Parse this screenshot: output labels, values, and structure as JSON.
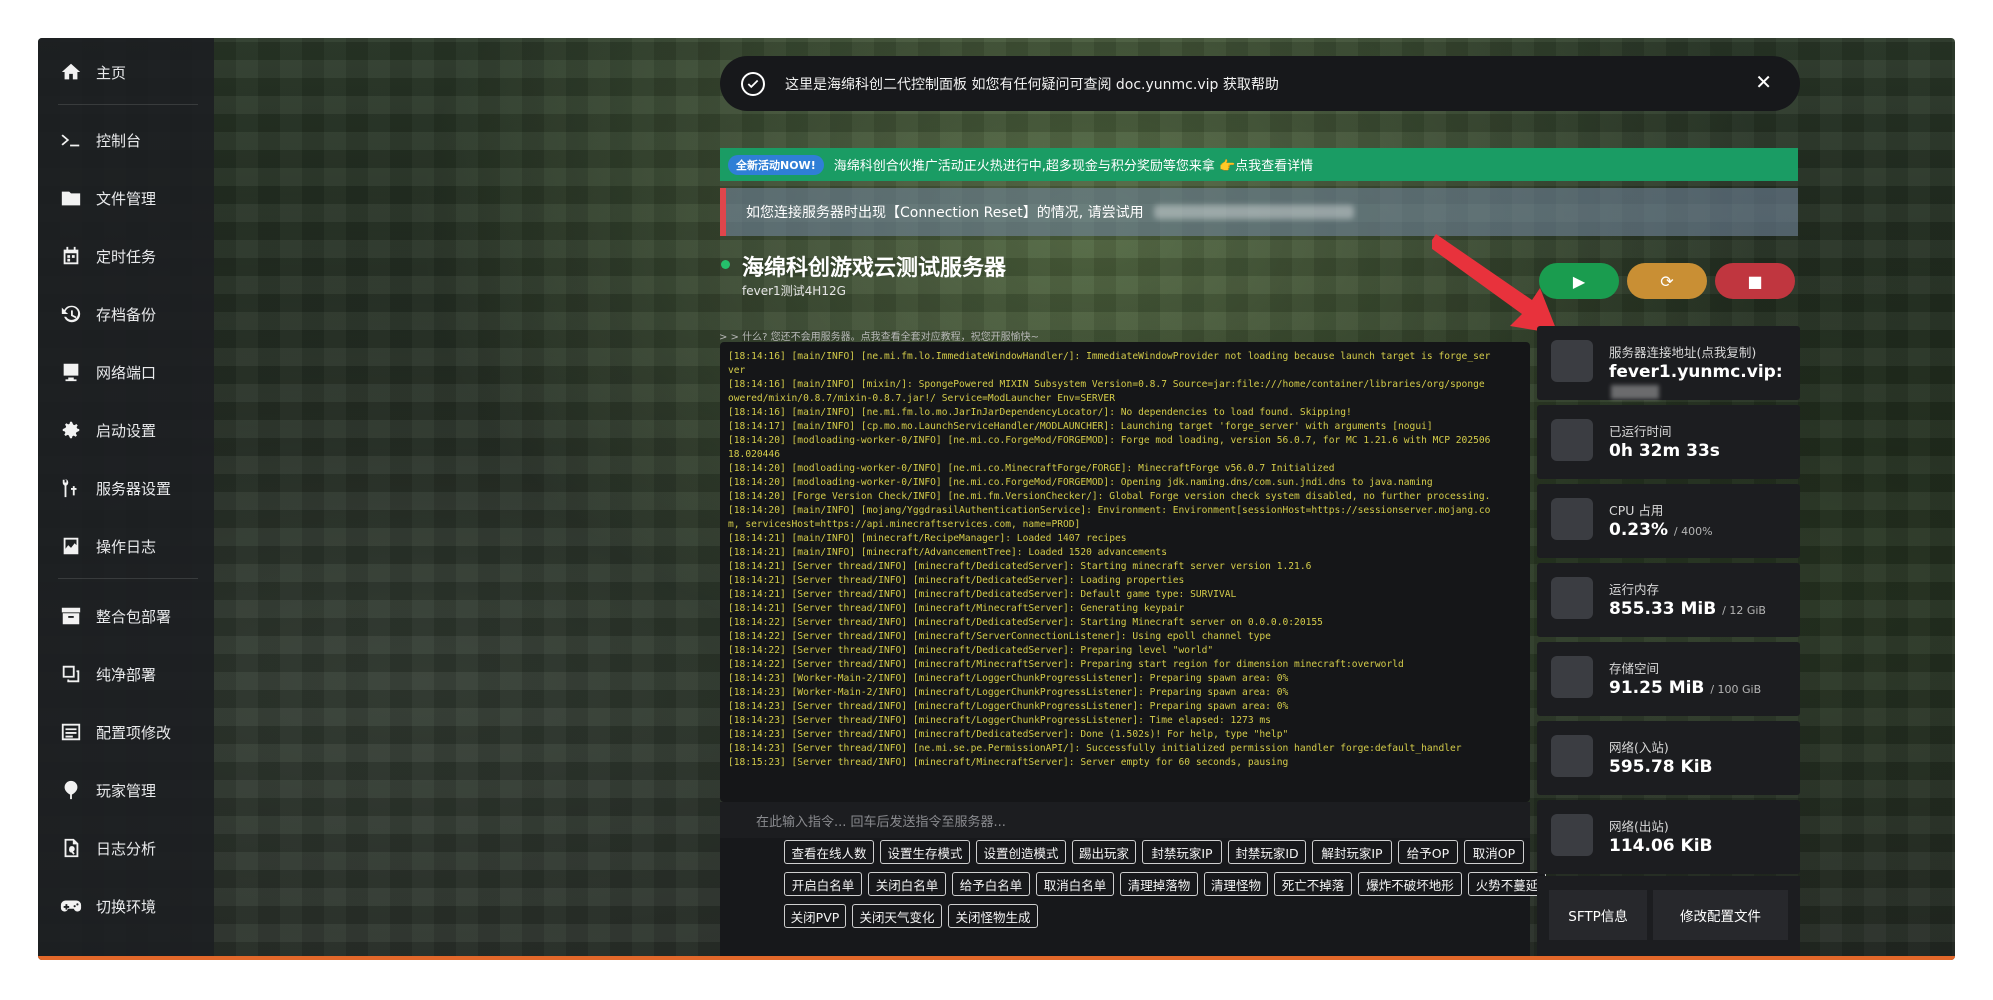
{
  "sidebar": {
    "items": [
      {
        "label": "主页",
        "icon": "home-icon"
      },
      {
        "label": "控制台",
        "icon": "terminal-icon"
      },
      {
        "label": "文件管理",
        "icon": "folder-icon"
      },
      {
        "label": "定时任务",
        "icon": "calendar-icon"
      },
      {
        "label": "存档备份",
        "icon": "backup-icon"
      },
      {
        "label": "网络端口",
        "icon": "network-icon"
      },
      {
        "label": "启动设置",
        "icon": "gear-icon"
      },
      {
        "label": "服务器设置",
        "icon": "wrench-icon"
      },
      {
        "label": "操作日志",
        "icon": "log-icon"
      },
      {
        "label": "整合包部署",
        "icon": "archive-icon"
      },
      {
        "label": "纯净部署",
        "icon": "copy-icon"
      },
      {
        "label": "配置项修改",
        "icon": "config-icon"
      },
      {
        "label": "玩家管理",
        "icon": "pin-icon"
      },
      {
        "label": "日志分析",
        "icon": "analysis-icon"
      },
      {
        "label": "切换环境",
        "icon": "gamepad-icon"
      }
    ]
  },
  "notice": {
    "text": "这里是海绵科创二代控制面板 如您有任何疑问可查阅 doc.yunmc.vip 获取帮助",
    "close": "✕"
  },
  "promo": {
    "badge": "全新活动NOW!",
    "text": "海绵科创合伙推广活动正火热进行中,超多现金与积分奖励等您来拿 👉点我查看详情"
  },
  "alert": {
    "text": "如您连接服务器时出现【Connection Reset】的情况, 请尝试用"
  },
  "server": {
    "title": "海绵科创游戏云测试服务器",
    "subtitle": "fever1测试4H12G"
  },
  "console": {
    "hint": "> > 什么? 您还不会用服务器。点我查看全套对应教程，祝您开服愉快~",
    "lines": [
      "[18:14:16] [main/INFO] [ne.mi.fm.lo.ImmediateWindowHandler/]: ImmediateWindowProvider not loading because launch target is forge_ser",
      "ver",
      "[18:14:16] [main/INFO] [mixin/]: SpongePowered MIXIN Subsystem Version=0.8.7 Source=jar:file:///home/container/libraries/org/sponge",
      "owered/mixin/0.8.7/mixin-0.8.7.jar!/ Service=ModLauncher Env=SERVER",
      "[18:14:16] [main/INFO] [ne.mi.fm.lo.mo.JarInJarDependencyLocator/]: No dependencies to load found. Skipping!",
      "[18:14:17] [main/INFO] [cp.mo.mo.LaunchServiceHandler/MODLAUNCHER]: Launching target 'forge_server' with arguments [nogui]",
      "[18:14:20] [modloading-worker-0/INFO] [ne.mi.co.ForgeMod/FORGEMOD]: Forge mod loading, version 56.0.7, for MC 1.21.6 with MCP 202506",
      "18.020446",
      "[18:14:20] [modloading-worker-0/INFO] [ne.mi.co.MinecraftForge/FORGE]: MinecraftForge v56.0.7 Initialized",
      "[18:14:20] [modloading-worker-0/INFO] [ne.mi.co.ForgeMod/FORGEMOD]: Opening jdk.naming.dns/com.sun.jndi.dns to java.naming",
      "[18:14:20] [Forge Version Check/INFO] [ne.mi.fm.VersionChecker/]: Global Forge version check system disabled, no further processing.",
      "[18:14:20] [main/INFO] [mojang/YggdrasilAuthenticationService]: Environment: Environment[sessionHost=https://sessionserver.mojang.co",
      "m, servicesHost=https://api.minecraftservices.com, name=PROD]",
      "[18:14:21] [main/INFO] [minecraft/RecipeManager]: Loaded 1407 recipes",
      "[18:14:21] [main/INFO] [minecraft/AdvancementTree]: Loaded 1520 advancements",
      "[18:14:21] [Server thread/INFO] [minecraft/DedicatedServer]: Starting minecraft server version 1.21.6",
      "[18:14:21] [Server thread/INFO] [minecraft/DedicatedServer]: Loading properties",
      "[18:14:21] [Server thread/INFO] [minecraft/DedicatedServer]: Default game type: SURVIVAL",
      "[18:14:21] [Server thread/INFO] [minecraft/MinecraftServer]: Generating keypair",
      "[18:14:22] [Server thread/INFO] [minecraft/DedicatedServer]: Starting Minecraft server on 0.0.0.0:20155",
      "[18:14:22] [Server thread/INFO] [minecraft/ServerConnectionListener]: Using epoll channel type",
      "[18:14:22] [Server thread/INFO] [minecraft/DedicatedServer]: Preparing level \"world\"",
      "[18:14:22] [Server thread/INFO] [minecraft/MinecraftServer]: Preparing start region for dimension minecraft:overworld",
      "[18:14:23] [Worker-Main-2/INFO] [minecraft/LoggerChunkProgressListener]: Preparing spawn area: 0%",
      "[18:14:23] [Worker-Main-2/INFO] [minecraft/LoggerChunkProgressListener]: Preparing spawn area: 0%",
      "[18:14:23] [Server thread/INFO] [minecraft/LoggerChunkProgressListener]: Preparing spawn area: 0%",
      "[18:14:23] [Server thread/INFO] [minecraft/LoggerChunkProgressListener]: Time elapsed: 1273 ms",
      "[18:14:23] [Server thread/INFO] [minecraft/DedicatedServer]: Done (1.502s)! For help, type \"help\"",
      "[18:14:23] [Server thread/INFO] [ne.mi.se.pe.PermissionAPI/]: Successfully initialized permission handler forge:default_handler",
      "[18:15:23] [Server thread/INFO] [minecraft/MinecraftServer]: Server empty for 60 seconds, pausing"
    ],
    "input_placeholder": "在此输入指令... 回车后发送指令至服务器..."
  },
  "quick_buttons": [
    [
      "查看在线人数",
      "设置生存模式",
      "设置创造模式",
      "踢出玩家",
      "封禁玩家IP",
      "封禁玩家ID",
      "解封玩家IP",
      "给予OP",
      "取消OP"
    ],
    [
      "开启白名单",
      "关闭白名单",
      "给予白名单",
      "取消白名单",
      "清理掉落物",
      "清理怪物",
      "死亡不掉落",
      "爆炸不破坏地形",
      "火势不蔓延"
    ],
    [
      "关闭PVP",
      "关闭天气变化",
      "关闭怪物生成"
    ]
  ],
  "power": {
    "start": "▶",
    "restart": "⟳",
    "stop": "■"
  },
  "colors": {
    "start": "#1a9c4f",
    "restart": "#c98f34",
    "stop": "#c0363f"
  },
  "stats": [
    {
      "label": "服务器连接地址(点我复制)",
      "value": "fever1.yunmc.vip:",
      "suffix": ""
    },
    {
      "label": "已运行时间",
      "value": "0h 32m 33s",
      "suffix": ""
    },
    {
      "label": "CPU 占用",
      "value": "0.23%",
      "suffix": "/ 400%"
    },
    {
      "label": "运行内存",
      "value": "855.33 MiB",
      "suffix": "/ 12 GiB"
    },
    {
      "label": "存储空间",
      "value": "91.25 MiB",
      "suffix": "/ 100 GiB"
    },
    {
      "label": "网络(入站)",
      "value": "595.78 KiB",
      "suffix": ""
    },
    {
      "label": "网络(出站)",
      "value": "114.06 KiB",
      "suffix": ""
    }
  ],
  "bottom_buttons": {
    "sftp": "SFTP信息",
    "edit_config": "修改配置文件"
  }
}
